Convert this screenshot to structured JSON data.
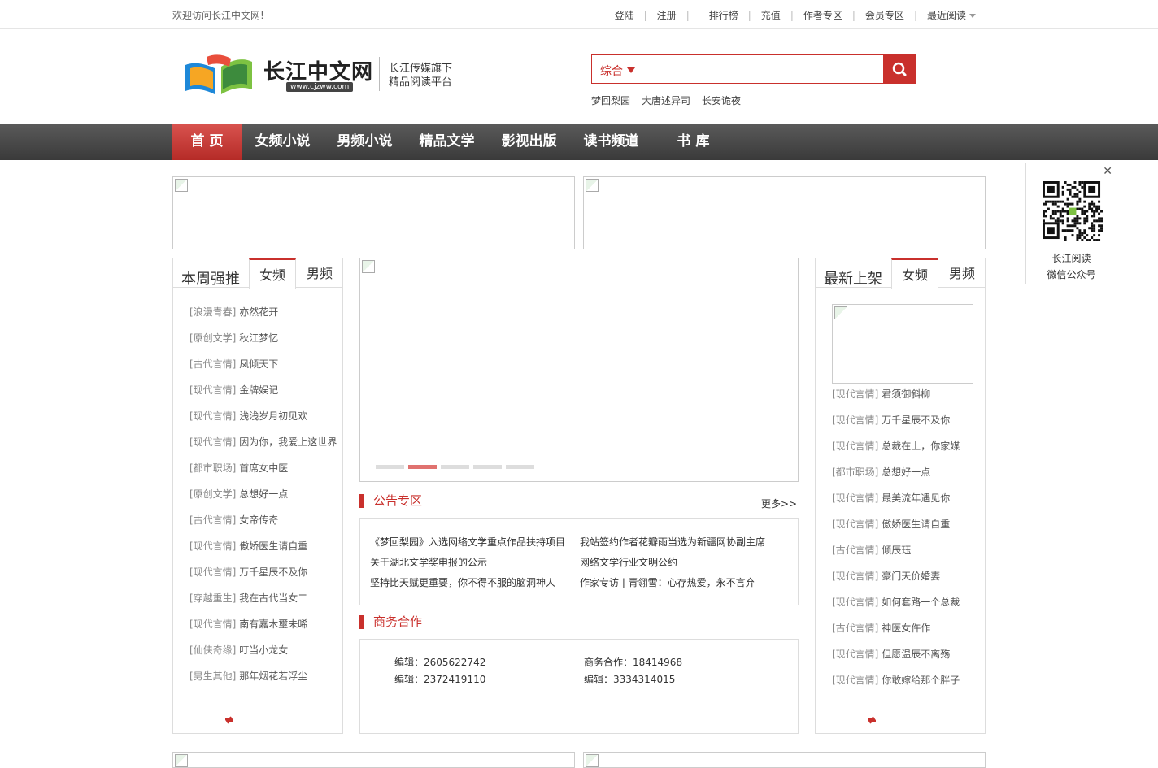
{
  "topbar": {
    "welcome": "欢迎访问长江中文网!",
    "links": [
      "登陆",
      "注册",
      "排行榜",
      "充值",
      "作者专区",
      "会员专区",
      "最近阅读"
    ]
  },
  "header": {
    "logo_text": "长江中文网",
    "logo_url": "www.cjzww.com",
    "slogan_line1": "长江传媒旗下",
    "slogan_line2": "精品阅读平台",
    "search_category": "综合",
    "search_placeholder": "",
    "hotwords": [
      "梦回梨园",
      "大唐述异司",
      "长安诡夜"
    ]
  },
  "nav": {
    "items": [
      "首 页",
      "女频小说",
      "男频小说",
      "精品文学",
      "影视出版",
      "读书频道",
      "书 库"
    ]
  },
  "left_panel": {
    "title": "本周强推",
    "tabs": [
      "女频",
      "男频"
    ],
    "items": [
      {
        "cat": "[浪漫青春]",
        "title": "亦然花开"
      },
      {
        "cat": "[原创文学]",
        "title": "秋江梦忆"
      },
      {
        "cat": "[古代言情]",
        "title": "凤倾天下"
      },
      {
        "cat": "[现代言情]",
        "title": "金牌娱记"
      },
      {
        "cat": "[现代言情]",
        "title": "浅浅岁月初见欢"
      },
      {
        "cat": "[现代言情]",
        "title": "因为你，我爱上这世界"
      },
      {
        "cat": "[都市职场]",
        "title": "首席女中医"
      },
      {
        "cat": "[原创文学]",
        "title": "总想好一点"
      },
      {
        "cat": "[古代言情]",
        "title": "女帝传奇"
      },
      {
        "cat": "[现代言情]",
        "title": "傲娇医生请自重"
      },
      {
        "cat": "[现代言情]",
        "title": "万千星辰不及你"
      },
      {
        "cat": "[穿越重生]",
        "title": "我在古代当女二"
      },
      {
        "cat": "[现代言情]",
        "title": "南有嘉木璽未晞"
      },
      {
        "cat": "[仙侠奇缘]",
        "title": "叮当小龙女"
      },
      {
        "cat": "[男生其他]",
        "title": "那年烟花若浮尘"
      }
    ]
  },
  "right_panel": {
    "title": "最新上架",
    "tabs": [
      "女频",
      "男频"
    ],
    "items": [
      {
        "cat": "[现代言情]",
        "title": "君须御斜柳"
      },
      {
        "cat": "[现代言情]",
        "title": "万千星辰不及你"
      },
      {
        "cat": "[现代言情]",
        "title": "总裁在上，你家媒"
      },
      {
        "cat": "[都市职场]",
        "title": "总想好一点"
      },
      {
        "cat": "[现代言情]",
        "title": "最美流年遇见你"
      },
      {
        "cat": "[现代言情]",
        "title": "傲娇医生请自重"
      },
      {
        "cat": "[古代言情]",
        "title": "倾辰珏"
      },
      {
        "cat": "[现代言情]",
        "title": "豪门天价婚妻"
      },
      {
        "cat": "[现代言情]",
        "title": "如何套路一个总裁"
      },
      {
        "cat": "[古代言情]",
        "title": "神医女仵作"
      },
      {
        "cat": "[现代言情]",
        "title": "但愿温辰不离殇"
      },
      {
        "cat": "[现代言情]",
        "title": "你敢嫁给那个胖子"
      }
    ]
  },
  "notice": {
    "title": "公告专区",
    "more": "更多>>",
    "col1": [
      "《梦回梨园》入选网络文学重点作品扶持项目",
      "关于湖北文学奖申报的公示",
      "坚持比天赋更重要，你不得不服的脑洞神人"
    ],
    "col2": [
      "我站签约作者花瓣雨当选为新疆网协副主席",
      "网络文学行业文明公约",
      "作家专访 | 青翎雪：心存热爱，永不言弃"
    ]
  },
  "business": {
    "title": "商务合作",
    "editor1": "编辑：2605622742",
    "editor2": "编辑：2372419110",
    "biz1": "商务合作：18414968",
    "biz2": "编辑：3334314015"
  },
  "qr": {
    "close": "✕",
    "caption1": "长江阅读",
    "caption2": "微信公众号"
  },
  "colors": {
    "accent": "#c9302c",
    "nav_bg": "#444444"
  }
}
